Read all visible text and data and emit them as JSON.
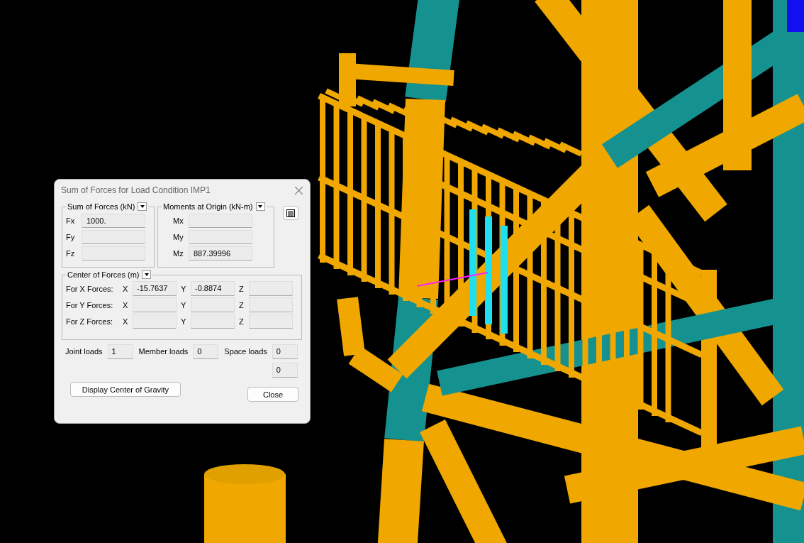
{
  "dialog": {
    "title": "Sum of Forces for Load Condition IMP1",
    "sum_of_forces": {
      "title": "Sum of Forces (kN)",
      "rows": [
        {
          "label": "Fx",
          "value": "1000."
        },
        {
          "label": "Fy"
        },
        {
          "label": "Fz"
        }
      ]
    },
    "moments": {
      "title": "Moments at Origin (kN-m)",
      "rows": [
        {
          "label": "Mx"
        },
        {
          "label": "My"
        },
        {
          "label": "Mz",
          "value": "887.39996"
        }
      ]
    },
    "center_of_forces": {
      "title": "Center of Forces (m)",
      "rows": [
        {
          "label": "For X Forces:",
          "axes": [
            {
              "label": "X",
              "value": "-15.7637"
            },
            {
              "label": "Y",
              "value": "-0.8874"
            },
            {
              "label": "Z"
            }
          ]
        },
        {
          "label": "For Y Forces:",
          "axes": [
            {
              "label": "X"
            },
            {
              "label": "Y"
            },
            {
              "label": "Z"
            }
          ]
        },
        {
          "label": "For Z Forces:",
          "axes": [
            {
              "label": "X"
            },
            {
              "label": "Y"
            },
            {
              "label": "Z"
            }
          ]
        }
      ]
    },
    "loads": [
      {
        "label": "Joint loads",
        "values": [
          "1"
        ]
      },
      {
        "label": "Member loads",
        "values": [
          "0"
        ]
      },
      {
        "label": "Space loads",
        "values": [
          "0",
          "0"
        ]
      }
    ],
    "buttons": [
      "Display Center of Gravity",
      "Close"
    ]
  }
}
